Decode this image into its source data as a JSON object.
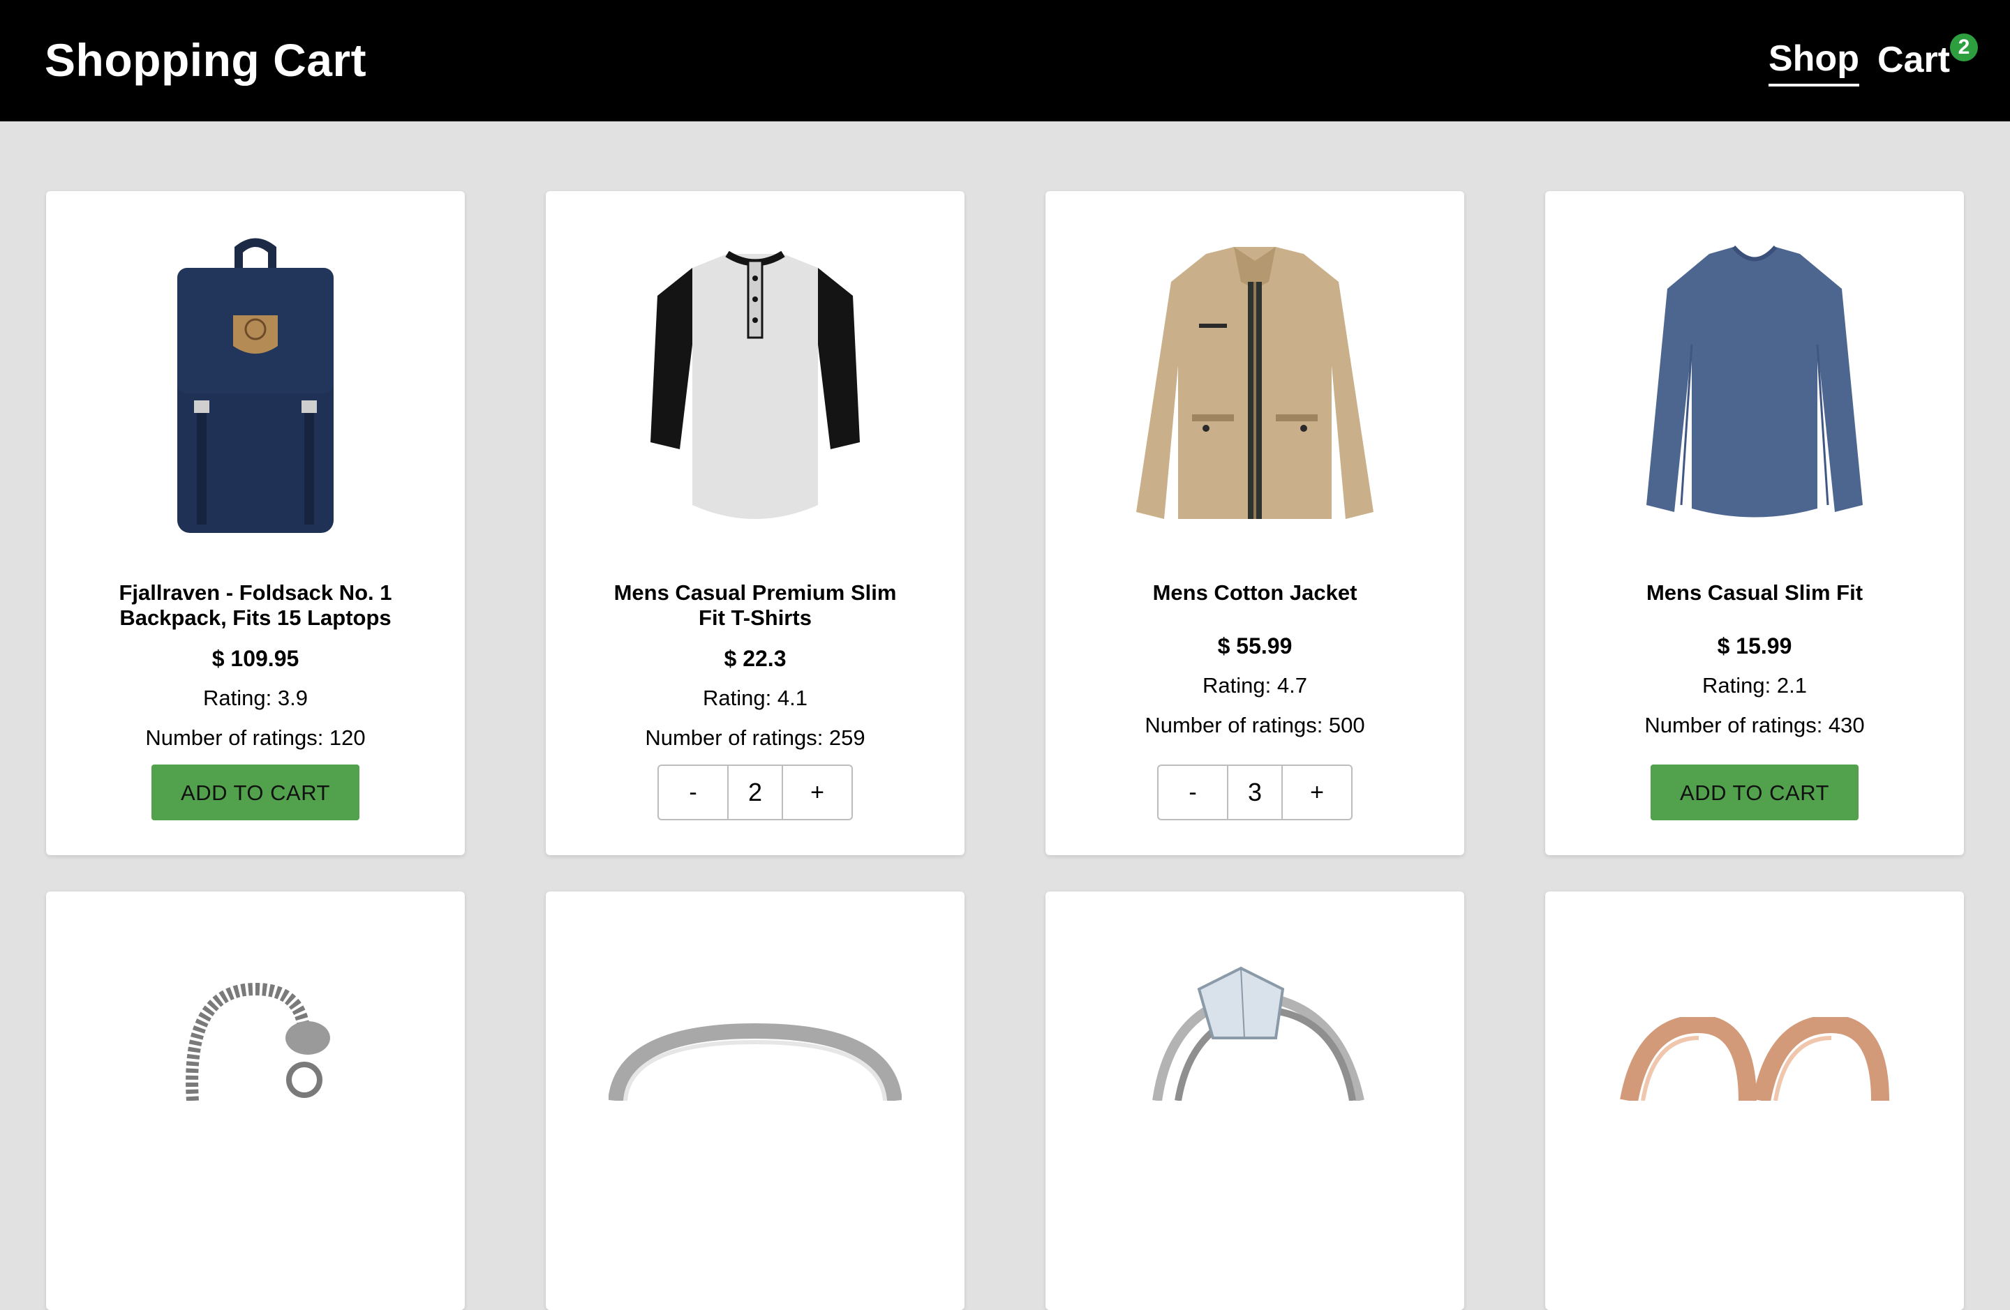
{
  "header": {
    "title": "Shopping Cart",
    "nav": [
      {
        "label": "Shop",
        "active": true
      },
      {
        "label": "Cart",
        "badge": "2"
      }
    ],
    "badge_color": "#2e9f3f"
  },
  "products": [
    {
      "title": "Fjallraven - Foldsack No. 1 Backpack, Fits 15 Laptops",
      "price": "$ 109.95",
      "rating": "Rating: 3.9",
      "count": "Number of ratings: 120",
      "image": "backpack-image",
      "action": "ADD TO CART"
    },
    {
      "title": "Mens Casual Premium Slim Fit T-Shirts",
      "price": "$ 22.3",
      "rating": "Rating: 4.1",
      "count": "Number of ratings: 259",
      "image": "tshirt-image",
      "quantity": "2",
      "minus": "-",
      "plus": "+"
    },
    {
      "title": "Mens Cotton Jacket",
      "price": "$ 55.99",
      "rating": "Rating: 4.7",
      "count": "Number of ratings: 500",
      "image": "jacket-image",
      "quantity": "3",
      "minus": "-",
      "plus": "+"
    },
    {
      "title": "Mens Casual Slim Fit",
      "price": "$ 15.99",
      "rating": "Rating: 2.1",
      "count": "Number of ratings: 430",
      "image": "longsleeve-image",
      "action": "ADD TO CART"
    }
  ],
  "more_products": [
    {
      "image": "bracelet-image"
    },
    {
      "image": "ring-image"
    },
    {
      "image": "diamond-ring-image"
    },
    {
      "image": "earrings-image"
    }
  ],
  "colors": {
    "header_bg": "#000000",
    "page_bg": "#e1e1e1",
    "add_button": "#52a24d"
  }
}
